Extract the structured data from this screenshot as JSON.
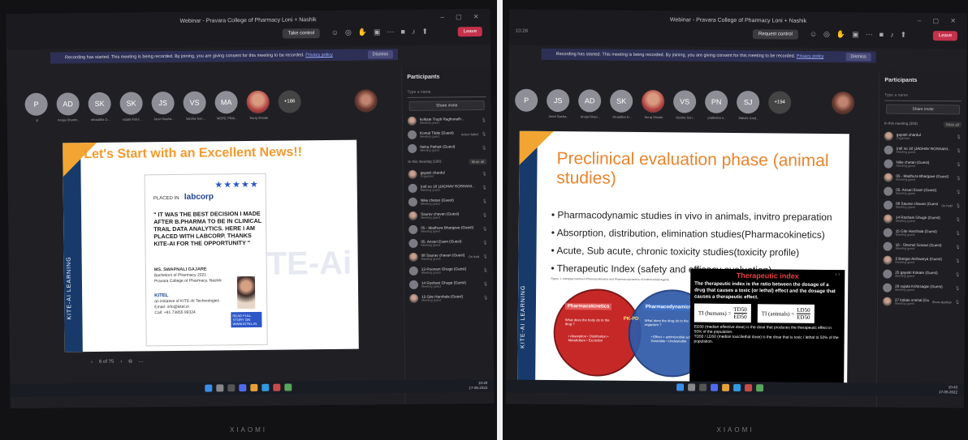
{
  "left": {
    "window_title": "Webinar - Pravara College of Pharmacy Loni + Nashik",
    "primary_button": "Take control",
    "leave_label": "Leave",
    "banner_text": "Recording has started. This meeting is being recorded. By joining, you are giving consent for this meeting to be recorded.",
    "banner_link": "Privacy policy",
    "dismiss": "Dismiss",
    "avatars": [
      {
        "initials": "P",
        "name": "yt"
      },
      {
        "initials": "AD",
        "name": "Anuja Dhamn..."
      },
      {
        "initials": "SK",
        "name": "shraddha D..."
      },
      {
        "initials": "SK",
        "name": "sujata Kolur..."
      },
      {
        "initials": "JS",
        "name": "Janvi Sasha..."
      },
      {
        "initials": "VS",
        "name": "Varsha Son..."
      },
      {
        "initials": "MA",
        "name": "MOPE PRAI..."
      },
      {
        "initials": "",
        "name": "Suraj Shinde"
      },
      {
        "initials": "+186",
        "name": ""
      }
    ],
    "slide": {
      "title": "Let's Start with an Excellent News!!",
      "side_label": "KITE-AI LEARNING",
      "placed_in": "PLACED IN",
      "company": "labcorp",
      "stars": "★★★★★",
      "quote": "\" IT WAS THE BEST DECISION I MADE AFTER B.PHARMA TO BE IN CLINICAL TRAIL DATA ANALYTICS. HERE I AM PLACED WITH LABCORP. THANKS KITE-AI FOR THE OPPORTUNITY \"",
      "person_name": "MS. SWAPNALI GAJARE",
      "person_line1": "Bachelors of Pharmacy 2021",
      "person_line2": "Pravara College of Pharmacy, Nashik",
      "kitel": "KITEL",
      "kitel_line1": "an initiative of KITE-AI Technologies",
      "kitel_line2": "Email: info@kitel.in",
      "kitel_line3": "Call: +91 73855 99324",
      "story": "READ FULL STORY ON WWW.KITEL.IN",
      "watermark": "TE-Ai"
    },
    "slide_counter": "6 of 75",
    "panel": {
      "title": "Participants",
      "search": "Type a name",
      "invite": "Share invite",
      "section": "In this meeting (190)",
      "view_all": "Mute all",
      "people": [
        {
          "name": "kolkate Trupti Raghunath...",
          "role": "Meeting guest",
          "status": ""
        },
        {
          "name": "Komal Tilole (Guest)",
          "role": "Meeting guest",
          "status": "Action failed"
        },
        {
          "name": "Neha Pathak (Guest)",
          "role": "Meeting guest",
          "status": ""
        },
        {
          "name": "gayatri chardul",
          "role": "Organizer",
          "status": ""
        },
        {
          "name": "(roll no 18 )JADHAV ROSHANI...",
          "role": "Meeting guest",
          "status": ""
        },
        {
          "name": "Nike chetan (Guest)",
          "role": "Meeting guest",
          "status": ""
        },
        {
          "name": "Saurav chavan (Guest)",
          "role": "Meeting guest",
          "status": ""
        },
        {
          "name": "05 - Madhura Bhargave (Guest)",
          "role": "Meeting guest",
          "status": ""
        },
        {
          "name": "05. Ansari Esam (Guest)",
          "role": "Meeting guest",
          "status": ""
        },
        {
          "name": "08 Saurav chavan (Guest)",
          "role": "Meeting guest",
          "status": "On hold"
        },
        {
          "name": "12-Poonam Ghuge (Guest)",
          "role": "Meeting guest",
          "status": ""
        },
        {
          "name": "14 Roshani Ghuge (Guest)",
          "role": "Meeting guest",
          "status": ""
        },
        {
          "name": "15 Gite Harshala (Guest)",
          "role": "Meeting guest",
          "status": ""
        }
      ]
    },
    "tray_time": "10:28",
    "tray_date": "17-05-2022",
    "brand": "XIAOMI"
  },
  "right": {
    "window_title": "Webinar - Pravara College of Pharmacy Loni + Nashik",
    "primary_button": "Request control",
    "leave_label": "Leave",
    "banner_text": "Recording has started. This meeting is being recorded. By joining, you are giving consent for this meeting to be recorded.",
    "banner_link": "Privacy policy",
    "dismiss": "Dismiss",
    "clock": "10:28",
    "avatars": [
      {
        "initials": "P",
        "name": ""
      },
      {
        "initials": "JS",
        "name": "Janvi Sasha..."
      },
      {
        "initials": "AD",
        "name": "Anuja Dhan..."
      },
      {
        "initials": "SK",
        "name": "shraddha D..."
      },
      {
        "initials": "",
        "name": "Suraj Shinde"
      },
      {
        "initials": "VS",
        "name": "Varsha Son..."
      },
      {
        "initials": "PN",
        "name": "pratiksha n..."
      },
      {
        "initials": "SJ",
        "name": "Sakshi Jund..."
      },
      {
        "initials": "+194",
        "name": ""
      }
    ],
    "slide": {
      "title": "Preclinical evaluation phase (animal studies)",
      "side_label": "KITE-AI LEARNING",
      "bullets": [
        "Pharmacodynamic studies in vivo in animals, invitro preparation",
        "Absorption, distribution, elimination studies(Pharmacokinetics)",
        "Acute, Sub acute, chronic toxicity studies(toxicity profile)",
        "Therapeutic Index (safety and efficacy evaluation)"
      ],
      "caption": "Figure 1: Interplay between Pharmacokinetics and Pharmacodynamics of Antimicrobial Agents",
      "pk_label": "Pharmacokinetics",
      "pd_label": "Pharmacodynamics",
      "pkpd": "PK-PD",
      "pk_question": "What does the body do to the drug ?",
      "pd_question": "What does the drug do to the organism ?",
      "pk_items": "• Absorption • Distribution • Metabolism • Excretion",
      "pd_items": "• Effect = antimicrobial activity • Desirable • Undesirable",
      "ti_title": "Therapeutic index",
      "ti_desc": "The therapeutic index is the ratio between the dosage of a drug that causes a toxic (or lethal) effect and the dosage that causes a therapeutic effect.",
      "ti_humans": "TI (humans) =",
      "ti_animals": "TI (animals) =",
      "td50": "TD50",
      "ed50": "ED50",
      "ld50": "LD50",
      "ti_note1": "ED50 (median effective dose) is the dose that produces the therapeutic effect in 50% of the population.",
      "ti_note2": "TD50 / LD50 (median toxic/lethal dose) is the dose that is toxic / lethal to 50% of the population."
    },
    "panel": {
      "title": "Participants",
      "search": "Type a name",
      "invite": "Share invite",
      "section": "In this meeting (203)",
      "view_all": "Mute all",
      "people": [
        {
          "name": "gayatri chardul",
          "role": "Organizer",
          "status": ""
        },
        {
          "name": "(roll no 18 )JADHAV ROSHANI...",
          "role": "Meeting guest",
          "status": ""
        },
        {
          "name": "Nike chetan (Guest)",
          "role": "Meeting guest",
          "status": ""
        },
        {
          "name": "05 - Madhura Bhargave (Guest)",
          "role": "Meeting guest",
          "status": ""
        },
        {
          "name": "05. Ansari Esam (Guest)",
          "role": "Meeting guest",
          "status": ""
        },
        {
          "name": "08 Saurav chavan (Guest)",
          "role": "Meeting guest",
          "status": "On hold"
        },
        {
          "name": "14 Roshani Ghuge (Guest)",
          "role": "Meeting guest",
          "status": ""
        },
        {
          "name": "15 Gite Harshala (Guest)",
          "role": "Meeting guest",
          "status": ""
        },
        {
          "name": "16 - Shemel Gosavi (Guest)",
          "role": "Meeting guest",
          "status": ""
        },
        {
          "name": "2 Bangar Aishwarya (Guest)",
          "role": "Meeting guest",
          "status": ""
        },
        {
          "name": "25 gayatri Kokate (Guest)",
          "role": "Meeting guest",
          "status": ""
        },
        {
          "name": "26 sujata Kshirsagar (Guest)",
          "role": "Meeting guest",
          "status": ""
        },
        {
          "name": "27 kolate snehal (Guest)",
          "role": "Meeting guest",
          "status": "Show desktop"
        }
      ]
    },
    "tray_time": "10:43",
    "tray_date": "17-05-2022",
    "brand": "XIAOMI"
  },
  "colors": {
    "accent_orange": "#f29a2e",
    "teams_bg": "#202024",
    "leave_red": "#c4314b",
    "stripe_blue": "#173a6b"
  }
}
